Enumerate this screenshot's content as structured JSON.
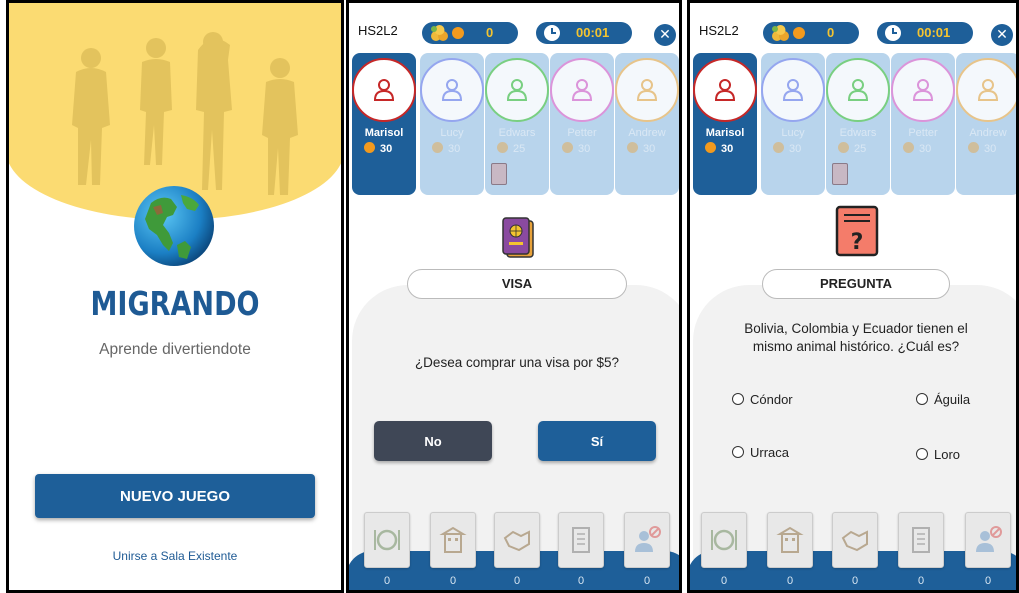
{
  "screen1": {
    "title": "MIGRANDO",
    "subtitle": "Aprende divertiendote",
    "new_game_label": "NUEVO JUEGO",
    "join_label": "Unirse a Sala Existente"
  },
  "screen2": {
    "room": "HS2L2",
    "coins": "0",
    "timer": "00:01",
    "close_label": "✕",
    "players": [
      {
        "name": "Marisol",
        "coins": "30",
        "color": "#c62828"
      },
      {
        "name": "Lucy",
        "coins": "30",
        "color": "#8f9ff0"
      },
      {
        "name": "Edwars",
        "coins": "25",
        "color": "#6fcf6f"
      },
      {
        "name": "Petter",
        "coins": "30",
        "color": "#e28ad8"
      },
      {
        "name": "Andrew",
        "coins": "30",
        "color": "#f0c27a"
      }
    ],
    "card_label": "VISA",
    "question": "¿Desea comprar una visa por $5?",
    "no_label": "No",
    "yes_label": "Sí",
    "slot_counts": [
      "0",
      "0",
      "0",
      "0",
      "0"
    ]
  },
  "screen3": {
    "room": "HS2L2",
    "coins": "0",
    "timer": "00:01",
    "close_label": "✕",
    "players": [
      {
        "name": "Marisol",
        "coins": "30"
      },
      {
        "name": "Lucy",
        "coins": "30"
      },
      {
        "name": "Edwars",
        "coins": "25"
      },
      {
        "name": "Petter",
        "coins": "30"
      },
      {
        "name": "Andrew",
        "coins": "30"
      }
    ],
    "card_label": "PREGUNTA",
    "question_line1": "Bolivia, Colombia y Ecuador tienen el",
    "question_line2": "mismo animal histórico. ¿Cuál es?",
    "options": [
      "Cóndor",
      "Águila",
      "Urraca",
      "Loro"
    ],
    "slot_counts": [
      "0",
      "0",
      "0",
      "0",
      "0"
    ]
  },
  "colors": {
    "brand_blue": "#1e5f99",
    "sun_yellow": "#fbdb72",
    "coin_orange": "#f29a1e",
    "coin_text": "#f4c430",
    "no_button": "#3f4756"
  },
  "icons": [
    "people-silhouette-icon",
    "globe-icon",
    "coin-heap-icon",
    "coin-icon",
    "clock-icon",
    "close-icon",
    "user-icon",
    "passport-icon",
    "question-card-icon",
    "food-icon",
    "building-icon",
    "handshake-icon",
    "office-icon",
    "restricted-person-icon"
  ]
}
